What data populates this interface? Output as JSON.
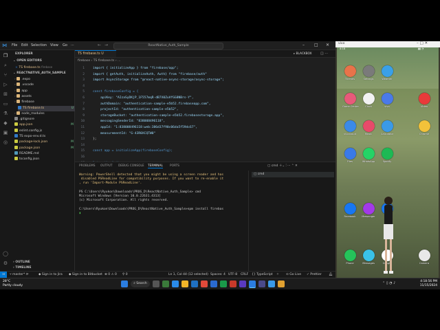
{
  "vscode": {
    "menu": [
      "File",
      "Edit",
      "Selection",
      "View",
      "Go"
    ],
    "search_text": "ReactNative_Auth_Sample",
    "explorer_title": "EXPLORER",
    "open_editors_title": "OPEN EDITORS",
    "open_editor_file": "TS firebase.ts",
    "open_editor_path": "firebase",
    "project_title": "REACTNATIVE_AUTH_SAMPLE",
    "tree": [
      {
        "label": ".expo",
        "color": "#dcb67a",
        "badge": ""
      },
      {
        "label": ".vscode",
        "color": "#dcb67a",
        "badge": ""
      },
      {
        "label": "app",
        "color": "#dcb67a",
        "badge": ""
      },
      {
        "label": "assets",
        "color": "#dcb67a",
        "badge": ""
      },
      {
        "label": "firebase",
        "color": "#dcb67a",
        "badge": ""
      },
      {
        "label": "TS firebase.ts",
        "color": "#3178c6",
        "badge": "U"
      },
      {
        "label": "node_modules",
        "color": "#dcb67a",
        "badge": ""
      },
      {
        "label": ".gitignore",
        "color": "#888888",
        "badge": ""
      },
      {
        "label": "app.json",
        "color": "#cbcb41",
        "badge": "M"
      },
      {
        "label": "eslint.config.js",
        "color": "#cbcb41",
        "badge": ""
      },
      {
        "label": "TS expo-env.d.ts",
        "color": "#3178c6",
        "badge": ""
      },
      {
        "label": "package-lock.json",
        "color": "#cbcb41",
        "badge": "M"
      },
      {
        "label": "package.json",
        "color": "#cbcb41",
        "badge": "M"
      },
      {
        "label": "README.md",
        "color": "#519aba",
        "badge": ""
      },
      {
        "label": "tsconfig.json",
        "color": "#cbcb41",
        "badge": ""
      }
    ],
    "outline": "OUTLINE",
    "timeline": "TIMELINE",
    "tab_label": "TS firebase.ts  U",
    "blackbox": "BLACKBOX",
    "breadcrumb": "firebase › TS firebase.ts › ...",
    "code": [
      {
        "n": "1",
        "t": "import { initializeApp } from \"firebase/app\";"
      },
      {
        "n": "2",
        "t": "import { getAuth, initializeAuth, Auth} from \"firebase/auth\""
      },
      {
        "n": "3",
        "t": "import AsyncStorage from \"@react-native-async-storage/async-storage\";"
      },
      {
        "n": "4",
        "t": ""
      },
      {
        "n": "5",
        "t": "const firebaseConfig = {"
      },
      {
        "n": "6",
        "t": "    apiKey: \"AIzaSyDKjP_1F557mqR-dB7X0ZuVfGG8NBrs-Y\","
      },
      {
        "n": "7",
        "t": "    authDomain: \"authentication-sample-e5b52.firebaseapp.com\","
      },
      {
        "n": "8",
        "t": "    projectId: \"authentication-sample-e5b52\","
      },
      {
        "n": "9",
        "t": "    storageBucket: \"authentication-sample-e5b52.firebasestorage.app\","
      },
      {
        "n": "10",
        "t": "    messagingSenderId: \"838008496118\","
      },
      {
        "n": "11",
        "t": "    appId: \"1:838008496118:web:386d37f90c06da5f59dc67\","
      },
      {
        "n": "12",
        "t": "    measurementId: \"G-43R0XCQTW0\""
      },
      {
        "n": "13",
        "t": "};"
      },
      {
        "n": "14",
        "t": ""
      },
      {
        "n": "15",
        "t": "const app = initializeApp(firebaseConfig);"
      },
      {
        "n": "16",
        "t": ""
      },
      {
        "n": "17",
        "t": "let auth: Auth;"
      }
    ],
    "panel_tabs": [
      "PROBLEMS",
      "OUTPUT",
      "DEBUG CONSOLE",
      "TERMINAL",
      "PORTS"
    ],
    "terminal_name": "cmd",
    "terminal_lines": [
      "Warning: PowerShell detected that you might be using a screen reader and has",
      " disabled PSReadLine for compatibility purposes. If you want to re-enable it",
      ", run 'Import-Module PSReadLine'.",
      "",
      "PS C:\\Users\\Ryukon\\Downloads\\PROG_D\\ReactNative_Auth_Sample> cmd",
      "Microsoft Windows [Version 10.0.22631.4313]",
      "(c) Microsoft Corporation. All rights reserved.",
      "",
      "C:\\Users\\Ryukon\\Downloads\\PROG_D\\ReactNative_Auth_Sample>npm install firebas"
    ],
    "terminal_list_item": "cmd",
    "status": {
      "branch": "master*",
      "sign_in": "Sign in to Jira",
      "bitbucket": "Sign in to Bitbucket",
      "problems": "⊗ 0 ⚠ 0",
      "ports": "0",
      "cursor": "Ln 1, Col 44 (12 selected)",
      "spaces": "Spaces: 4",
      "encoding": "UTF-8",
      "eol": "CRLF",
      "language": "TypeScript",
      "golive": "Go Live",
      "prettier": "Prettier"
    }
  },
  "phone": {
    "title": "vivo",
    "apps": [
      {
        "label": "Themes",
        "color": "#e8734a"
      },
      {
        "label": "Settings",
        "color": "#7a7a7a"
      },
      {
        "label": "Weather",
        "color": "#3aa0e8"
      },
      {
        "label": "Game Center",
        "color": "#e85a7a"
      },
      {
        "label": "Clock",
        "color": "#f2f2f2"
      },
      {
        "label": "vivo",
        "color": "#4a7ae8"
      },
      {
        "label": "Video",
        "color": "#e83a3a"
      },
      {
        "label": "vivoCloud",
        "color": "#3a8ae8"
      },
      {
        "label": "Music",
        "color": "#e84a6a"
      },
      {
        "label": "Calculator",
        "color": "#3a9ae8"
      },
      {
        "label": "Chrome",
        "color": "#f2c23a"
      },
      {
        "label": "Files",
        "color": "#3a7ae8"
      },
      {
        "label": "WhatsApp",
        "color": "#25d366"
      },
      {
        "label": "Spotify",
        "color": "#1db954"
      },
      {
        "label": "Facebook",
        "color": "#1877f2"
      },
      {
        "label": "Messenger",
        "color": "#a33ae8"
      },
      {
        "label": "Lite",
        "color": "#1877f2"
      },
      {
        "label": "Phone",
        "color": "#25c35a"
      },
      {
        "label": "Messages",
        "color": "#3ac2e8"
      },
      {
        "label": "Google",
        "color": "#ffffff"
      },
      {
        "label": "Camera",
        "color": "#e8e8e8"
      }
    ]
  },
  "taskbar": {
    "weather_temp": "28°C",
    "weather_text": "Partly cloudy",
    "search": "Search",
    "time": "4:18:56 PM",
    "date": "11/15/2024"
  }
}
